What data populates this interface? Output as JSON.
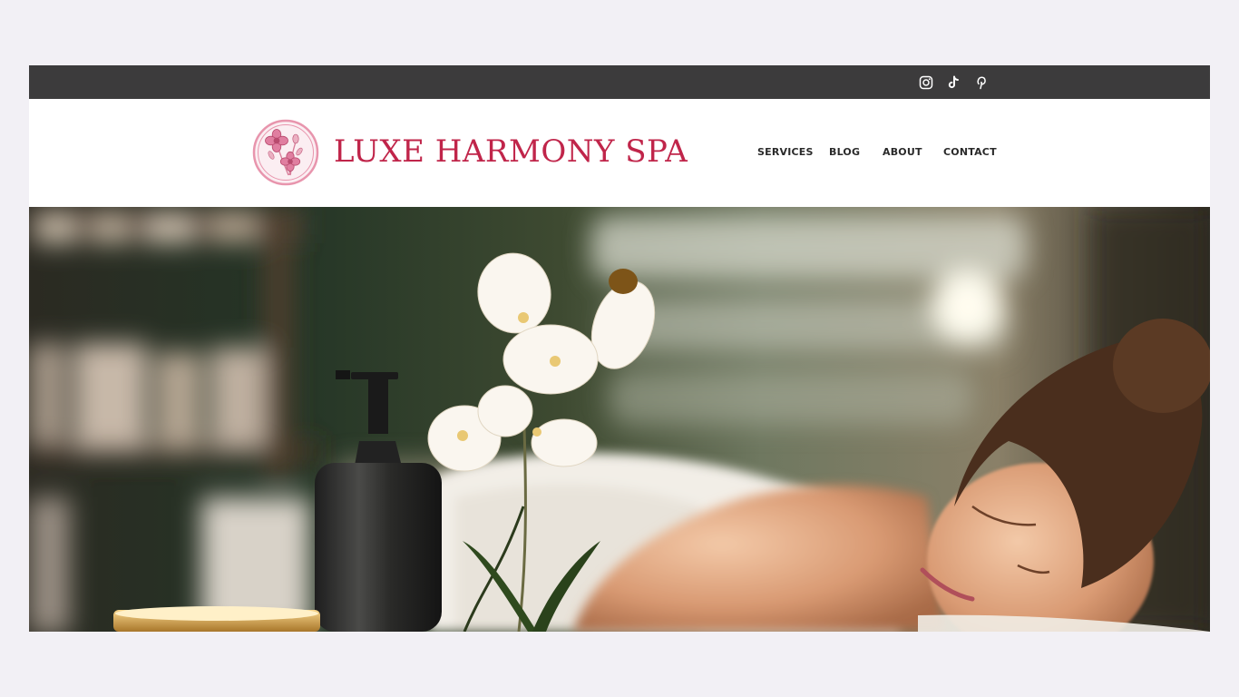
{
  "social": {
    "instagram_icon": "instagram-icon",
    "tiktok_icon": "tiktok-icon",
    "pinterest_icon": "pinterest-icon"
  },
  "header": {
    "brand": "LUXE HARMONY SPA",
    "logo_icon": "flower-logo-icon"
  },
  "nav": {
    "items": [
      {
        "label": "SERVICES"
      },
      {
        "label": "BLOG"
      },
      {
        "label": "ABOUT"
      },
      {
        "label": "CONTACT"
      }
    ]
  },
  "hero": {
    "image": "spa-massage-photo"
  },
  "colors": {
    "topbar": "#3c3b3c",
    "brand": "#c0254a",
    "logo_pink": "#e895ad",
    "nav_text": "#2a2a2a",
    "page_background": "#f2f0f5"
  }
}
